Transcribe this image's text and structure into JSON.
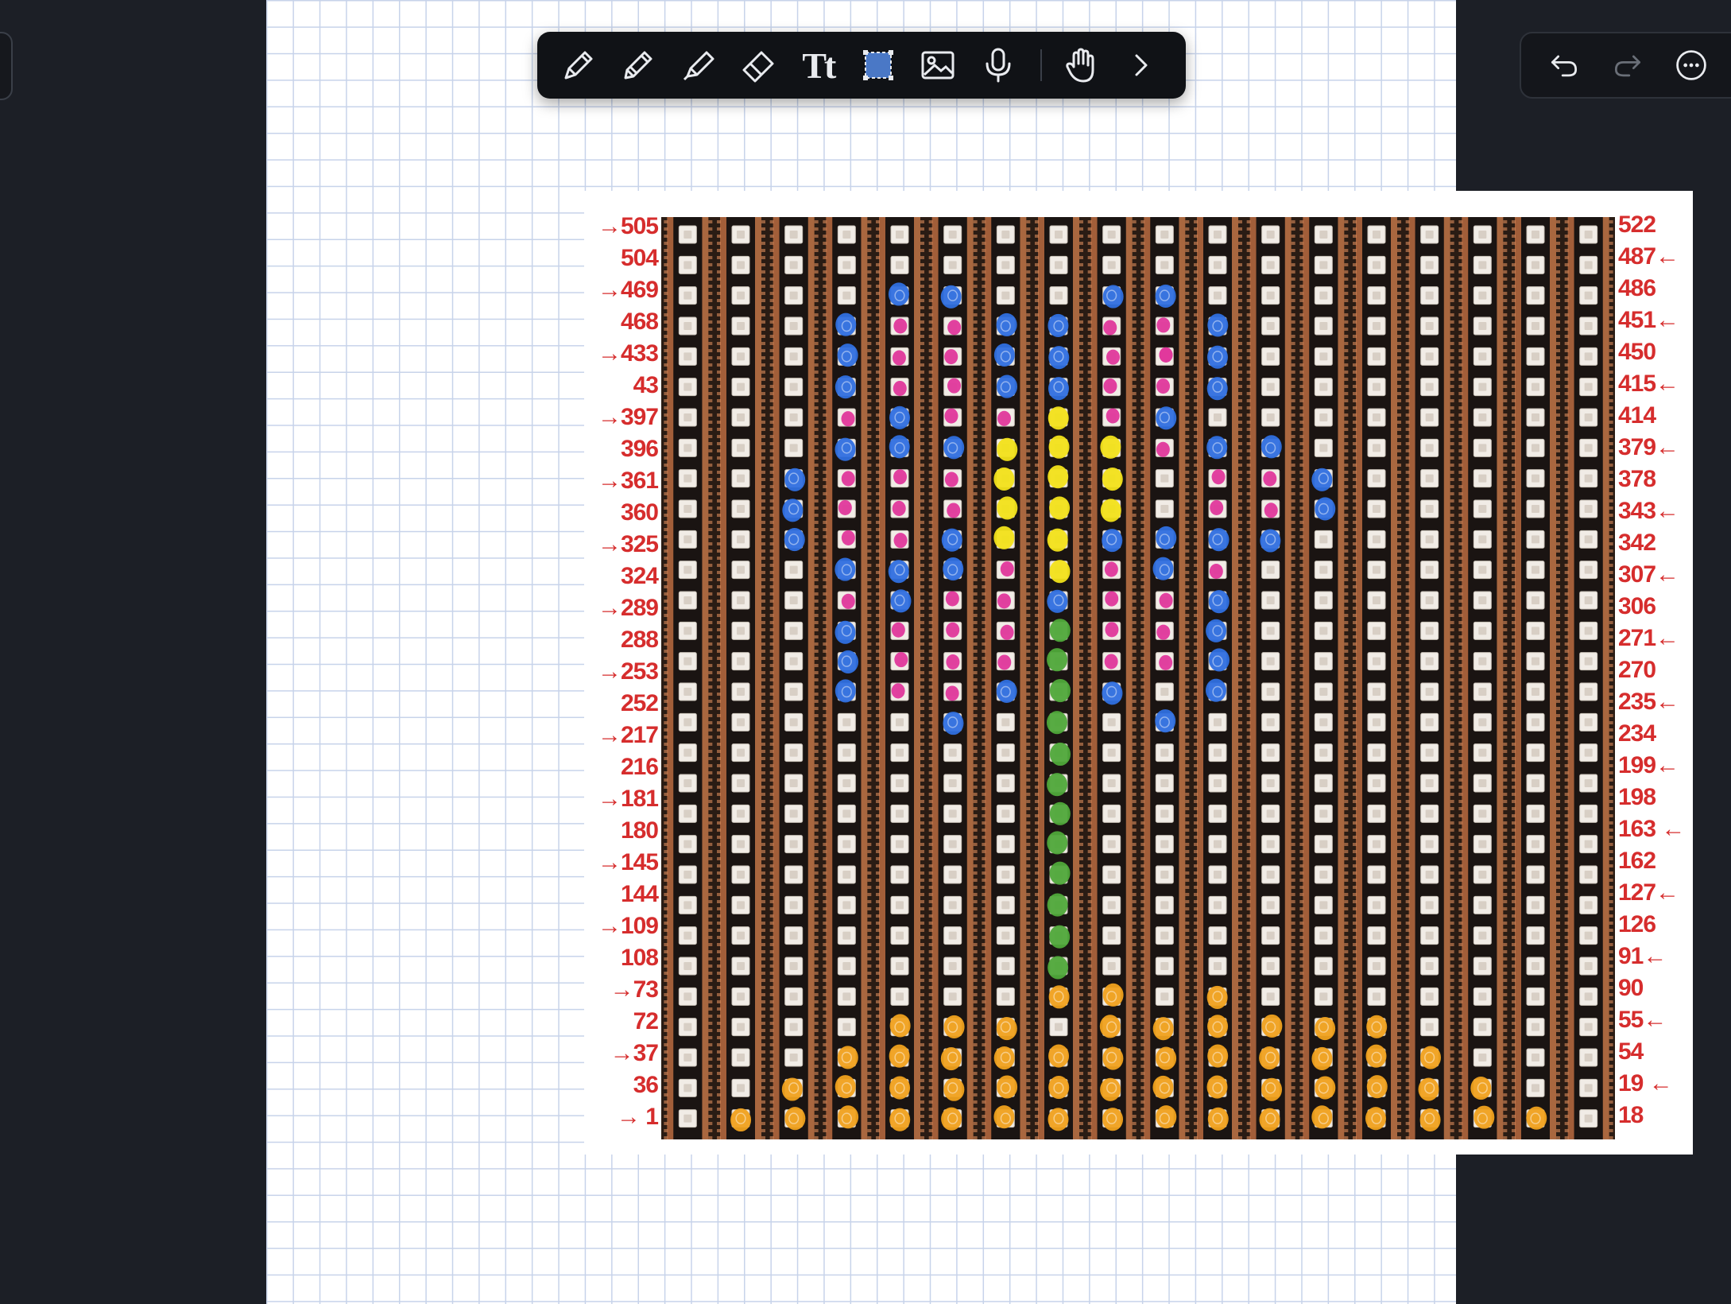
{
  "toolbar": {
    "tools": [
      {
        "name": "pen-tool",
        "icon": "pen-icon"
      },
      {
        "name": "pencil-tool",
        "icon": "pencil-icon"
      },
      {
        "name": "highlighter-tool",
        "icon": "highlighter-icon"
      },
      {
        "name": "eraser-tool",
        "icon": "eraser-icon"
      },
      {
        "name": "text-tool",
        "icon": "text-icon",
        "label": "Tt"
      },
      {
        "name": "lasso-tool",
        "icon": "lasso-select-icon",
        "selected": true
      },
      {
        "name": "image-tool",
        "icon": "image-icon"
      },
      {
        "name": "audio-tool",
        "icon": "microphone-icon"
      },
      {
        "name": "hand-tool",
        "icon": "hand-icon"
      },
      {
        "name": "more-tools",
        "icon": "chevron-right-icon"
      }
    ]
  },
  "right_toolbar": {
    "actions": [
      {
        "name": "undo",
        "icon": "undo-icon"
      },
      {
        "name": "redo",
        "icon": "redo-icon",
        "disabled": true
      },
      {
        "name": "more",
        "icon": "more-icon"
      }
    ]
  },
  "matrix": {
    "rows": 30,
    "cols": 18,
    "left_labels": [
      "→505",
      "504",
      "→469",
      "468",
      "→433",
      "43",
      "→397",
      "396",
      "→361",
      "360",
      "→325",
      "324",
      "→289",
      "288",
      "→253",
      "252",
      "→217",
      "216",
      "→181",
      "180",
      "→145",
      "144",
      "→109",
      "108",
      "→73",
      "72",
      "→37",
      "36",
      "→ 1"
    ],
    "right_labels": [
      "522",
      "487←",
      "486",
      "451←",
      "450",
      "415←",
      "414",
      "379←",
      "378",
      "343←",
      "342",
      "307←",
      "306",
      "271←",
      "270",
      "235←",
      "234",
      "199←",
      "198",
      "163 ←",
      "162",
      "127←",
      "126",
      "91←",
      "90",
      "55←",
      "54",
      "19 ←",
      "18"
    ],
    "colors": {
      "blue": "#2f6fe0",
      "pink": "#e0389c",
      "yellow": "#f2e21a",
      "green": "#4fa83a",
      "orange": "#f0a11e",
      "label_red": "#d62d2d"
    },
    "marks": [
      {
        "color": "blue",
        "cells": [
          [
            2,
            4
          ],
          [
            2,
            5
          ],
          [
            2,
            8
          ],
          [
            2,
            9
          ],
          [
            3,
            3
          ],
          [
            3,
            6
          ],
          [
            3,
            7
          ],
          [
            3,
            10
          ],
          [
            4,
            3
          ],
          [
            4,
            6
          ],
          [
            4,
            7
          ],
          [
            4,
            10
          ],
          [
            5,
            3
          ],
          [
            5,
            6
          ],
          [
            5,
            7
          ],
          [
            5,
            10
          ],
          [
            6,
            4
          ],
          [
            6,
            9
          ],
          [
            7,
            3
          ],
          [
            7,
            4
          ],
          [
            7,
            5
          ],
          [
            7,
            10
          ],
          [
            7,
            11
          ],
          [
            8,
            2
          ],
          [
            8,
            12
          ],
          [
            9,
            2
          ],
          [
            9,
            12
          ],
          [
            10,
            2
          ],
          [
            10,
            5
          ],
          [
            10,
            8
          ],
          [
            10,
            9
          ],
          [
            10,
            10
          ],
          [
            10,
            11
          ],
          [
            11,
            3
          ],
          [
            11,
            4
          ],
          [
            11,
            5
          ],
          [
            11,
            9
          ],
          [
            12,
            4
          ],
          [
            12,
            7
          ],
          [
            12,
            10
          ],
          [
            13,
            3
          ],
          [
            13,
            10
          ],
          [
            14,
            3
          ],
          [
            14,
            10
          ],
          [
            15,
            3
          ],
          [
            15,
            6
          ],
          [
            15,
            8
          ],
          [
            15,
            10
          ],
          [
            16,
            5
          ],
          [
            16,
            9
          ]
        ]
      },
      {
        "color": "pink",
        "cells": [
          [
            3,
            4
          ],
          [
            3,
            5
          ],
          [
            3,
            8
          ],
          [
            3,
            9
          ],
          [
            4,
            4
          ],
          [
            4,
            5
          ],
          [
            4,
            8
          ],
          [
            4,
            9
          ],
          [
            5,
            4
          ],
          [
            5,
            5
          ],
          [
            5,
            8
          ],
          [
            5,
            9
          ],
          [
            6,
            3
          ],
          [
            6,
            5
          ],
          [
            6,
            6
          ],
          [
            6,
            8
          ],
          [
            7,
            9
          ],
          [
            8,
            3
          ],
          [
            8,
            4
          ],
          [
            8,
            5
          ],
          [
            8,
            10
          ],
          [
            8,
            11
          ],
          [
            9,
            3
          ],
          [
            9,
            4
          ],
          [
            9,
            5
          ],
          [
            9,
            10
          ],
          [
            9,
            11
          ],
          [
            10,
            3
          ],
          [
            10,
            4
          ],
          [
            11,
            6
          ],
          [
            11,
            8
          ],
          [
            12,
            3
          ],
          [
            12,
            5
          ],
          [
            12,
            6
          ],
          [
            12,
            8
          ],
          [
            12,
            9
          ],
          [
            13,
            4
          ],
          [
            13,
            5
          ],
          [
            13,
            6
          ],
          [
            13,
            8
          ],
          [
            13,
            9
          ],
          [
            14,
            4
          ],
          [
            14,
            5
          ],
          [
            14,
            6
          ],
          [
            14,
            8
          ],
          [
            14,
            9
          ],
          [
            15,
            4
          ],
          [
            15,
            5
          ],
          [
            4,
            9
          ],
          [
            11,
            10
          ]
        ]
      },
      {
        "color": "yellow",
        "cells": [
          [
            6,
            7
          ],
          [
            7,
            6
          ],
          [
            7,
            7
          ],
          [
            7,
            8
          ],
          [
            8,
            6
          ],
          [
            8,
            7
          ],
          [
            8,
            8
          ],
          [
            9,
            6
          ],
          [
            9,
            7
          ],
          [
            9,
            8
          ],
          [
            10,
            6
          ],
          [
            10,
            7
          ],
          [
            11,
            7
          ]
        ]
      },
      {
        "color": "green",
        "cells": [
          [
            13,
            7
          ],
          [
            14,
            7
          ],
          [
            15,
            7
          ],
          [
            16,
            7
          ],
          [
            17,
            7
          ],
          [
            18,
            7
          ],
          [
            19,
            7
          ],
          [
            20,
            7
          ],
          [
            21,
            7
          ],
          [
            22,
            7
          ],
          [
            23,
            7
          ],
          [
            24,
            7
          ]
        ]
      },
      {
        "color": "orange",
        "cells": [
          [
            25,
            7
          ],
          [
            25,
            8
          ],
          [
            25,
            10
          ],
          [
            26,
            4
          ],
          [
            26,
            5
          ],
          [
            26,
            6
          ],
          [
            26,
            8
          ],
          [
            26,
            9
          ],
          [
            26,
            10
          ],
          [
            26,
            11
          ],
          [
            26,
            12
          ],
          [
            26,
            13
          ],
          [
            27,
            3
          ],
          [
            27,
            4
          ],
          [
            27,
            5
          ],
          [
            27,
            6
          ],
          [
            27,
            7
          ],
          [
            27,
            8
          ],
          [
            27,
            9
          ],
          [
            27,
            10
          ],
          [
            27,
            11
          ],
          [
            27,
            12
          ],
          [
            27,
            13
          ],
          [
            27,
            14
          ],
          [
            28,
            2
          ],
          [
            28,
            3
          ],
          [
            28,
            4
          ],
          [
            28,
            5
          ],
          [
            28,
            6
          ],
          [
            28,
            7
          ],
          [
            28,
            8
          ],
          [
            28,
            9
          ],
          [
            28,
            10
          ],
          [
            28,
            11
          ],
          [
            28,
            12
          ],
          [
            28,
            13
          ],
          [
            28,
            14
          ],
          [
            28,
            15
          ],
          [
            29,
            1
          ],
          [
            29,
            2
          ],
          [
            29,
            3
          ],
          [
            29,
            4
          ],
          [
            29,
            5
          ],
          [
            29,
            6
          ],
          [
            29,
            7
          ],
          [
            29,
            8
          ],
          [
            29,
            9
          ],
          [
            29,
            10
          ],
          [
            29,
            11
          ],
          [
            29,
            12
          ],
          [
            29,
            13
          ],
          [
            29,
            14
          ],
          [
            29,
            15
          ],
          [
            29,
            16
          ]
        ]
      }
    ]
  }
}
